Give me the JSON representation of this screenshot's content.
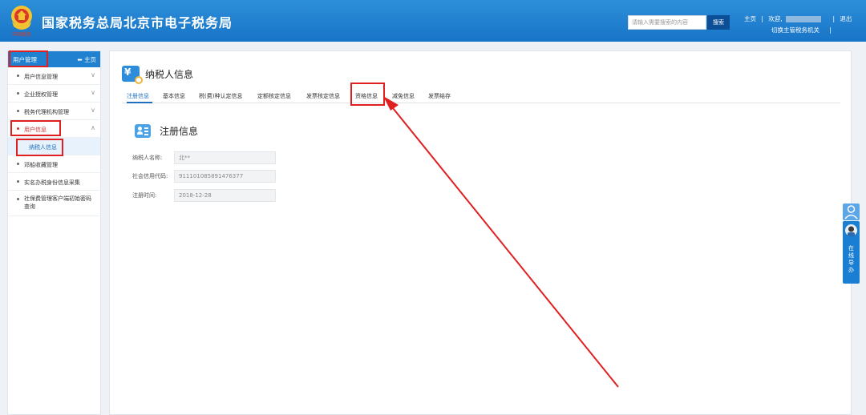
{
  "header": {
    "title": "国家税务总局北京市电子税务局",
    "emblem_text": "中国税务",
    "search_placeholder": "请输入需要搜索的内容",
    "search_button": "搜索",
    "links": {
      "home": "主页",
      "welcome": "欢迎,",
      "logout": "退出",
      "switch_org": "切换主管税务机关"
    },
    "colors": {
      "bar": "#1874c7",
      "search_button": "#0d4f96"
    }
  },
  "sidebar": {
    "title": "用户管理",
    "home_link": "主页",
    "items": [
      {
        "label": "用户信息管理",
        "expandable": true
      },
      {
        "label": "企业授权管理",
        "expandable": true
      },
      {
        "label": "税务代理机构管理",
        "expandable": true
      },
      {
        "label": "用户信息",
        "expandable": true,
        "expanded": true
      },
      {
        "label": "纳税人信息",
        "sub": true
      },
      {
        "label": "邓船收藏管理",
        "expandable": false
      },
      {
        "label": "实名办税身份信息采集",
        "expandable": false
      },
      {
        "label": "社保费管理客户端初始密码查询",
        "expandable": false
      }
    ]
  },
  "main": {
    "page_title": "纳税人信息",
    "tabs": [
      {
        "label": "注册信息",
        "active": true
      },
      {
        "label": "基本信息"
      },
      {
        "label": "税(费)种认定信息"
      },
      {
        "label": "定额核定信息"
      },
      {
        "label": "发票核定信息"
      },
      {
        "label": "资格信息"
      },
      {
        "label": "减免信息"
      },
      {
        "label": "发票结存"
      }
    ],
    "section_title": "注册信息",
    "fields": [
      {
        "label": "纳税人名称:",
        "value": "北**"
      },
      {
        "label": "社会信用代码:",
        "value": "911101085891476377"
      },
      {
        "label": "注册时间:",
        "value": "2018-12-28"
      }
    ]
  },
  "float_widget": {
    "label": "在线导办"
  },
  "annotation_color": "#e02020"
}
